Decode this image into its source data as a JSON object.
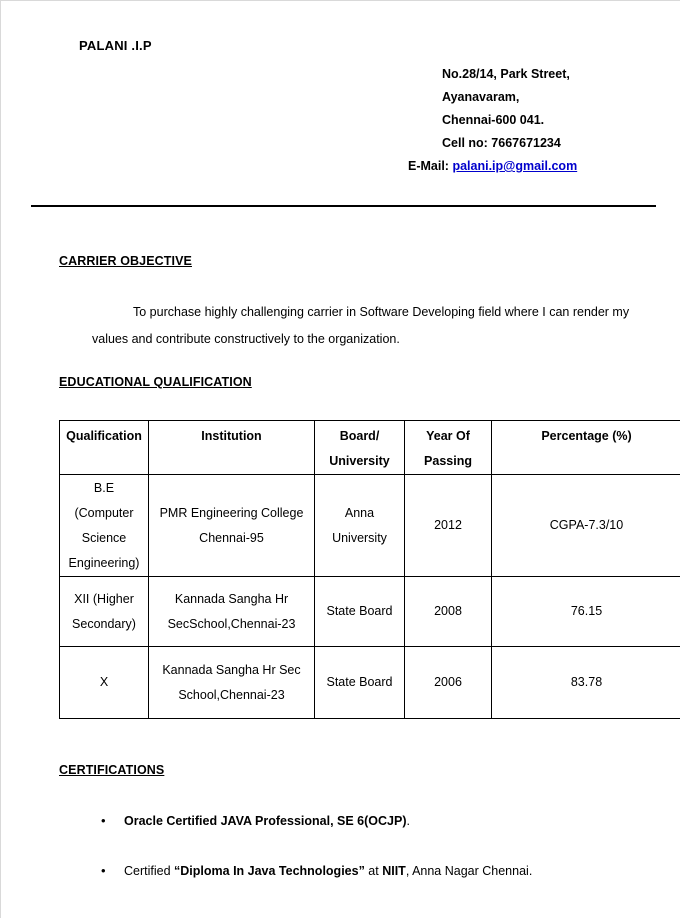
{
  "header": {
    "name": "PALANI .I.P",
    "address_lines": [
      "No.28/14, Park Street,",
      "Ayanavaram,",
      "Chennai-600 041.",
      "Cell no: 7667671234"
    ],
    "email_label": "E-Mail:",
    "email": "palani.ip@gmail.com",
    "email_color": "#0000CC"
  },
  "objective": {
    "heading": "CARRIER OBJECTIVE",
    "text": "To purchase highly challenging carrier in Software Developing field where I can render my values and contribute constructively to the organization."
  },
  "education": {
    "heading": "EDUCATIONAL QUALIFICATION",
    "columns": [
      {
        "line1": "Qualification",
        "line2": ""
      },
      {
        "line1": "Institution",
        "line2": ""
      },
      {
        "line1": "Board/",
        "line2": "University"
      },
      {
        "line1": "Year Of",
        "line2": "Passing"
      },
      {
        "line1": "Percentage (%)",
        "line2": ""
      }
    ],
    "rows": [
      {
        "qualification": [
          "B.E",
          "(Computer",
          "Science",
          "Engineering)"
        ],
        "institution": [
          "PMR Engineering College",
          "Chennai-95"
        ],
        "board": [
          "Anna",
          "University"
        ],
        "year": "2012",
        "percentage": "CGPA-7.3/10"
      },
      {
        "qualification": [
          "XII (Higher",
          "Secondary)"
        ],
        "institution": [
          "Kannada Sangha Hr",
          "SecSchool,Chennai-23"
        ],
        "board": [
          "State Board"
        ],
        "year": "2008",
        "percentage": "76.15"
      },
      {
        "qualification": [
          "X"
        ],
        "institution": [
          "Kannada Sangha Hr Sec",
          "School,Chennai-23"
        ],
        "board": [
          "State Board"
        ],
        "year": "2006",
        "percentage": "83.78"
      }
    ]
  },
  "certifications": {
    "heading": "CERTIFICATIONS",
    "bullet_glyph": "•",
    "items": [
      {
        "segments": [
          {
            "text": "Oracle Certified JAVA Professional, SE 6(OCJP)",
            "bold": true
          },
          {
            "text": ".",
            "bold": false
          }
        ]
      },
      {
        "segments": [
          {
            "text": "Certified ",
            "bold": false
          },
          {
            "text": "“Diploma In Java Technologies”",
            "bold": true
          },
          {
            "text": " at ",
            "bold": false
          },
          {
            "text": "NIIT",
            "bold": true
          },
          {
            "text": ", Anna Nagar  Chennai.",
            "bold": false
          }
        ]
      }
    ]
  }
}
